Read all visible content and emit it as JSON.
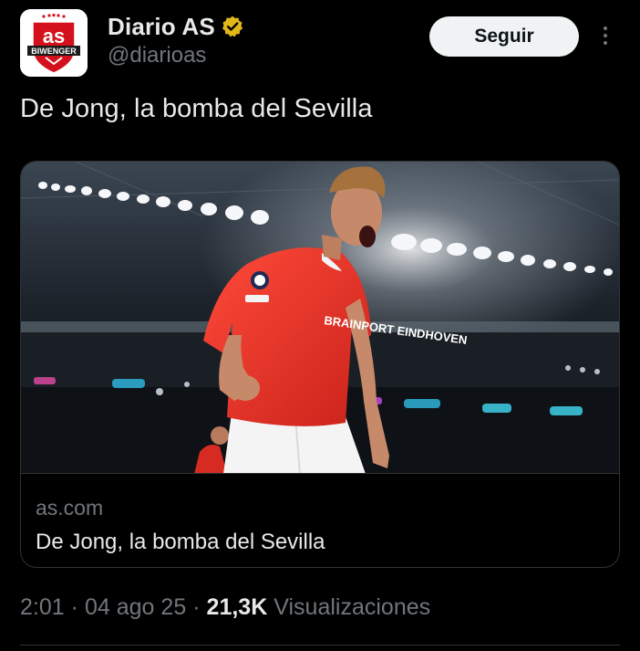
{
  "author": {
    "display_name": "Diario AS",
    "handle": "@diarioas",
    "verified_icon": "verified-gold-badge-icon",
    "avatar_logo": {
      "brand_text": "as",
      "sub_text": "BIWENGER",
      "accent_color": "#d4101c"
    }
  },
  "actions": {
    "follow_label": "Seguir",
    "more_icon": "more-vertical-icon"
  },
  "tweet": {
    "text": "De Jong, la bomba del Sevilla"
  },
  "link_card": {
    "image_description_icon": "photo-icon",
    "domain": "as.com",
    "title": "De Jong, la bomba del Sevilla",
    "image_jersey_text": "BRAINPORT EINDHOVEN"
  },
  "meta": {
    "time": "2:01",
    "separator": "·",
    "date": "04 ago 25",
    "views_count": "21,3K",
    "views_label": "Visualizaciones"
  },
  "colors": {
    "background": "#000000",
    "text_primary": "#e7e9ea",
    "text_secondary": "#71767b",
    "border": "#2f3336",
    "follow_bg": "#eff3f4",
    "verified_gold": "#e2b719",
    "jersey_red": "#e8342a"
  }
}
